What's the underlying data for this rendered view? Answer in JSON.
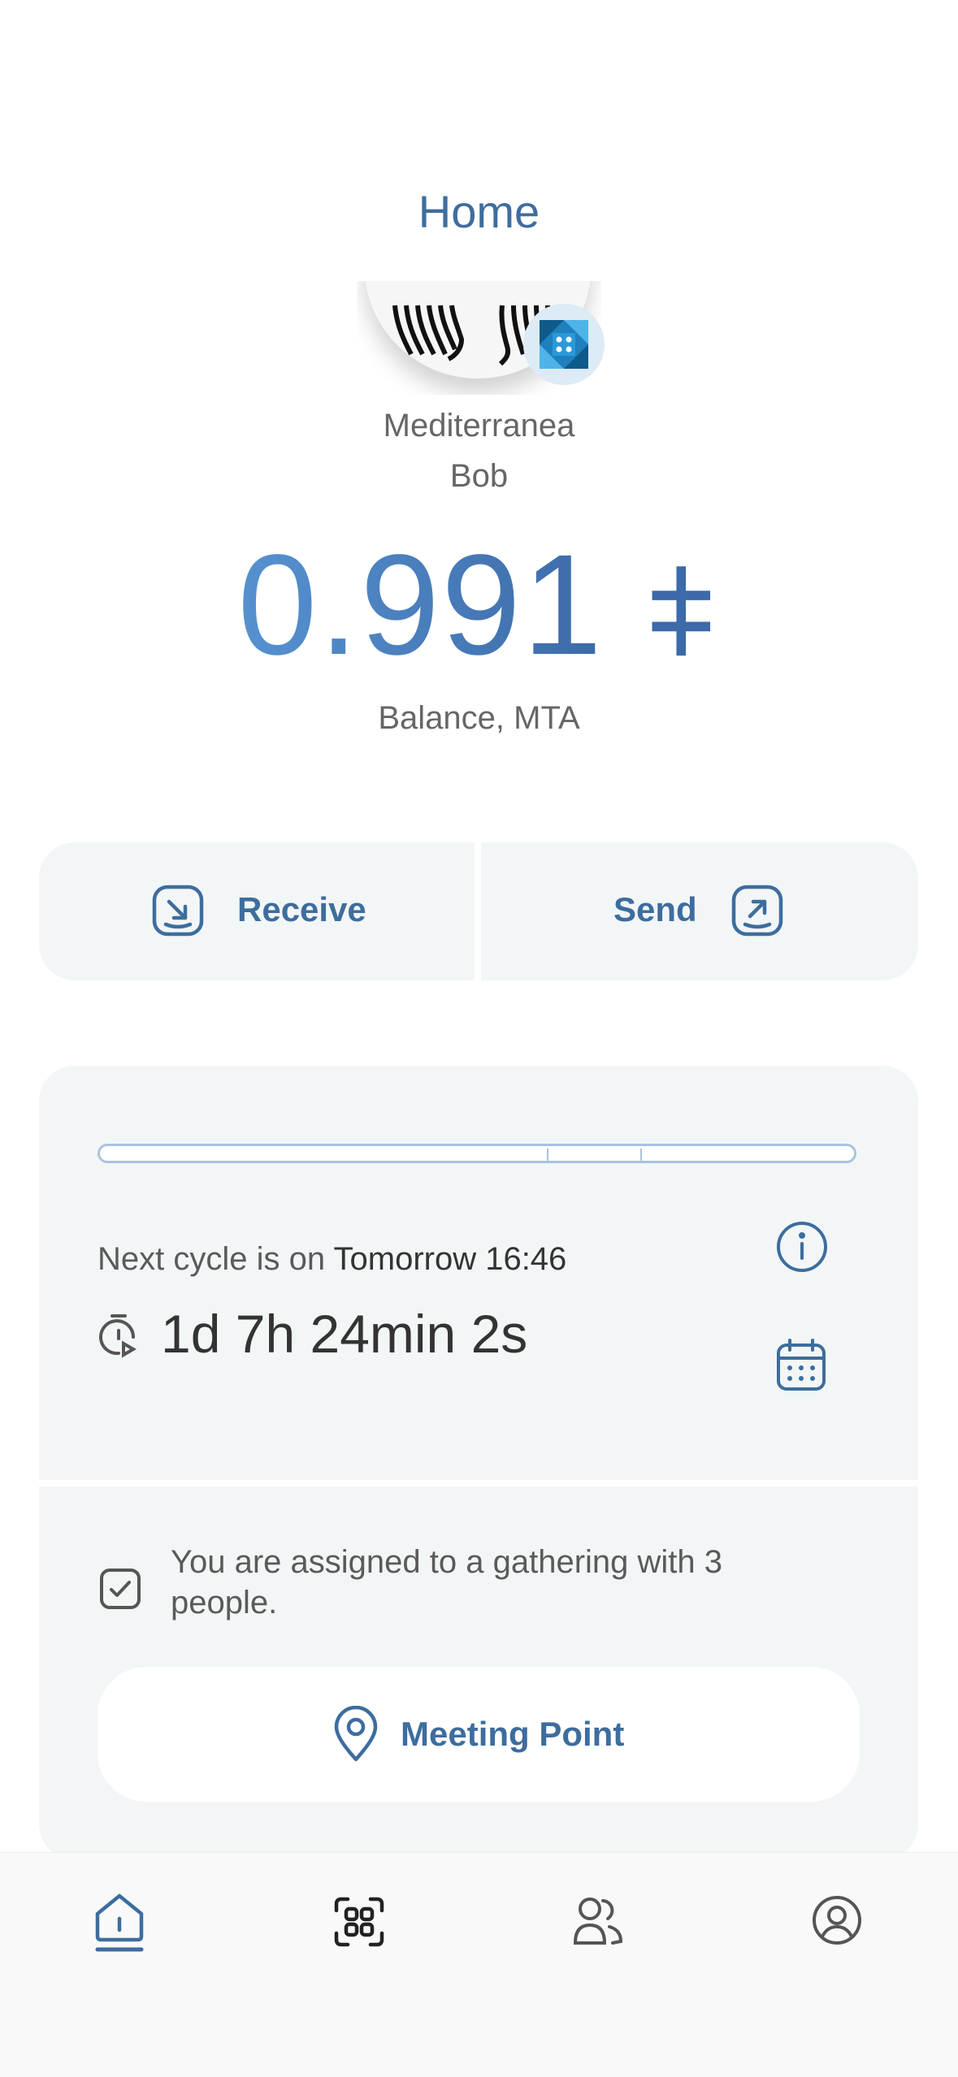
{
  "header": {
    "title": "Home"
  },
  "profile": {
    "name_line1": "Mediterranea",
    "name_line2": "Bob",
    "balance": "0.991",
    "currency_symbol": "⧧",
    "balance_label": "Balance, MTA"
  },
  "actions": {
    "receive_label": "Receive",
    "send_label": "Send"
  },
  "cycle": {
    "progress_markers": [
      "start",
      "marker-1",
      "marker-2",
      "end"
    ],
    "next_cycle_prefix": "Next cycle is on",
    "next_cycle_time": "Tomorrow 16:46",
    "countdown": "1d 7h 24min 2s"
  },
  "gathering": {
    "message": "You are assigned to a gathering with 3 people.",
    "meeting_point_label": "Meeting Point"
  },
  "tabbar": {
    "items": [
      {
        "icon": "home-icon",
        "active": true
      },
      {
        "icon": "qr-scan-icon",
        "active": false
      },
      {
        "icon": "contacts-icon",
        "active": false
      },
      {
        "icon": "profile-icon",
        "active": false
      }
    ]
  },
  "colors": {
    "accent": "#3d6d9e",
    "balance_gradient_start": "#5692d0",
    "balance_gradient_end": "#3d6aa8",
    "card_background": "#f3f6f7",
    "tabbar_background": "#f9f9f9"
  }
}
